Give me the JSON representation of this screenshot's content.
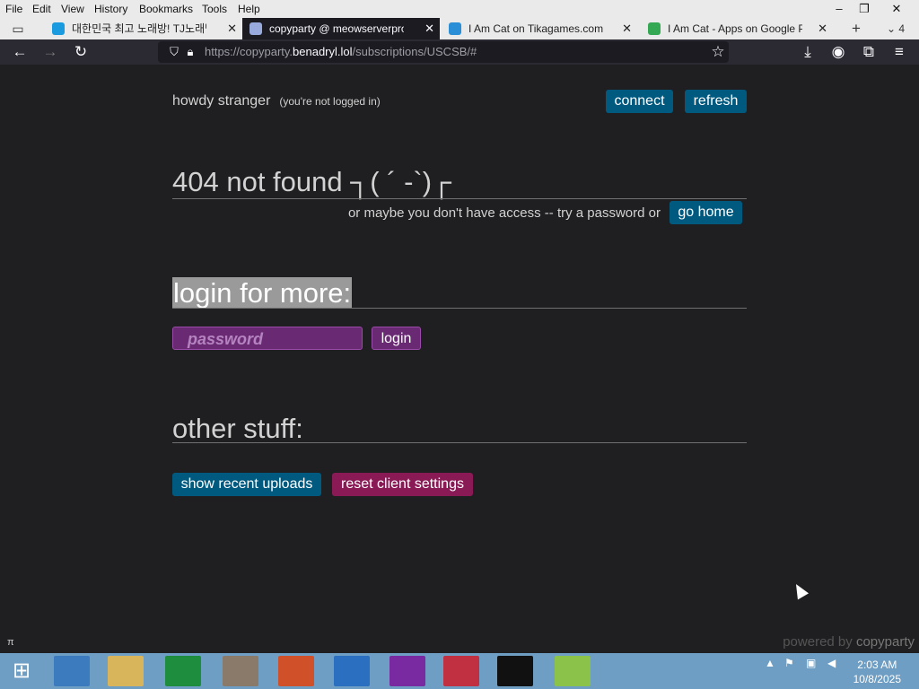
{
  "menu": [
    "File",
    "Edit",
    "View",
    "History",
    "Bookmarks",
    "Tools",
    "Help"
  ],
  "tabs": [
    {
      "label": "대한민국 최고 노래방! TJ노래방",
      "active": false,
      "color": "#1a9be0"
    },
    {
      "label": "copyparty @ meowserverpro",
      "active": true,
      "color": "#9ad"
    },
    {
      "label": "I Am Cat on Tikagames.com",
      "active": false,
      "color": "#2a8fd6"
    },
    {
      "label": "I Am Cat - Apps on Google Play",
      "active": false,
      "color": "#34a853"
    }
  ],
  "tab_count": "4",
  "url": {
    "prefix": "https://copyparty.",
    "domain": "benadryl.lol",
    "path": "/subscriptions/USCSB/#"
  },
  "page": {
    "greeting": "howdy stranger",
    "not_logged_in": "(you're not logged in)",
    "connect": "connect",
    "refresh": "refresh",
    "title_404": "404 not found  ┐( ´ -`)┌",
    "access_msg": "or maybe you don't have access -- try a password or",
    "go_home": "go home",
    "login_heading": "login for more:",
    "password_placeholder": "password",
    "login_button": "login",
    "other_heading": "other stuff:",
    "recent_uploads": "show recent uploads",
    "reset_settings": "reset client settings",
    "powered_by": "powered by",
    "powered_name": "copyparty",
    "pi_symbol": "π"
  },
  "clock": {
    "time": "2:03 AM",
    "date": "10/8/2025"
  }
}
